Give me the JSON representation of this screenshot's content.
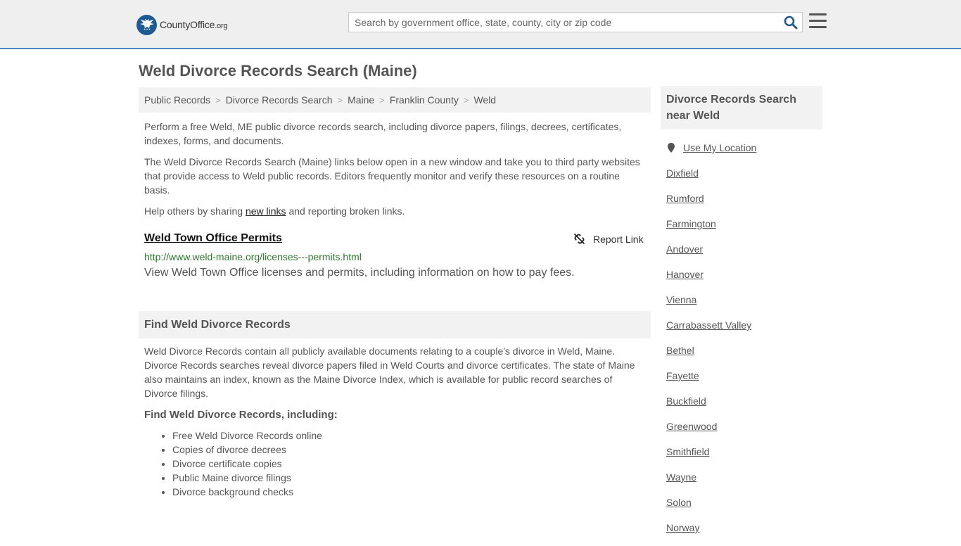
{
  "header": {
    "logo_main": "CountyOffice",
    "logo_suffix": ".org",
    "search_placeholder": "Search by government office, state, county, city or zip code"
  },
  "page": {
    "title": "Weld Divorce Records Search (Maine)"
  },
  "breadcrumb": [
    "Public Records",
    "Divorce Records Search",
    "Maine",
    "Franklin County",
    "Weld"
  ],
  "intro": {
    "p1": "Perform a free Weld, ME public divorce records search, including divorce papers, filings, decrees, certificates, indexes, forms, and documents.",
    "p2": "The Weld Divorce Records Search (Maine) links below open in a new window and take you to third party websites that provide access to Weld public records. Editors frequently monitor and verify these resources on a routine basis.",
    "p3_before": "Help others by sharing ",
    "p3_link": "new links",
    "p3_after": " and reporting broken links."
  },
  "result": {
    "title": "Weld Town Office Permits",
    "report_label": "Report Link",
    "url": "http://www.weld-maine.org/licenses---permits.html",
    "description": "View Weld Town Office licenses and permits, including information on how to pay fees."
  },
  "find_section": {
    "heading": "Find Weld Divorce Records",
    "body": "Weld Divorce Records contain all publicly available documents relating to a couple's divorce in Weld, Maine. Divorce Records searches reveal divorce papers filed in Weld Courts and divorce certificates. The state of Maine also maintains an index, known as the Maine Divorce Index, which is available for public record searches of Divorce filings.",
    "subheading": "Find Weld Divorce Records, including:",
    "items": [
      "Free Weld Divorce Records online",
      "Copies of divorce decrees",
      "Divorce certificate copies",
      "Public Maine divorce filings",
      "Divorce background checks"
    ]
  },
  "sidebar": {
    "heading": "Divorce Records Search near Weld",
    "use_location": "Use My Location",
    "places": [
      "Dixfield",
      "Rumford",
      "Farmington",
      "Andover",
      "Hanover",
      "Vienna",
      "Carrabassett Valley",
      "Bethel",
      "Fayette",
      "Buckfield",
      "Greenwood",
      "Smithfield",
      "Wayne",
      "Solon",
      "Norway"
    ]
  },
  "colors": {
    "header_bg": "#efefef",
    "header_border": "#4a86c5",
    "logo_badge": "#1e5a93",
    "search_icon": "#1e5a93",
    "url_green": "#2f7a2f",
    "panel_bg": "#f2f2f2"
  },
  "icons": {
    "search": "magnifier-icon",
    "menu": "hamburger-icon",
    "report": "broken-link-icon",
    "location": "map-pin-icon"
  }
}
